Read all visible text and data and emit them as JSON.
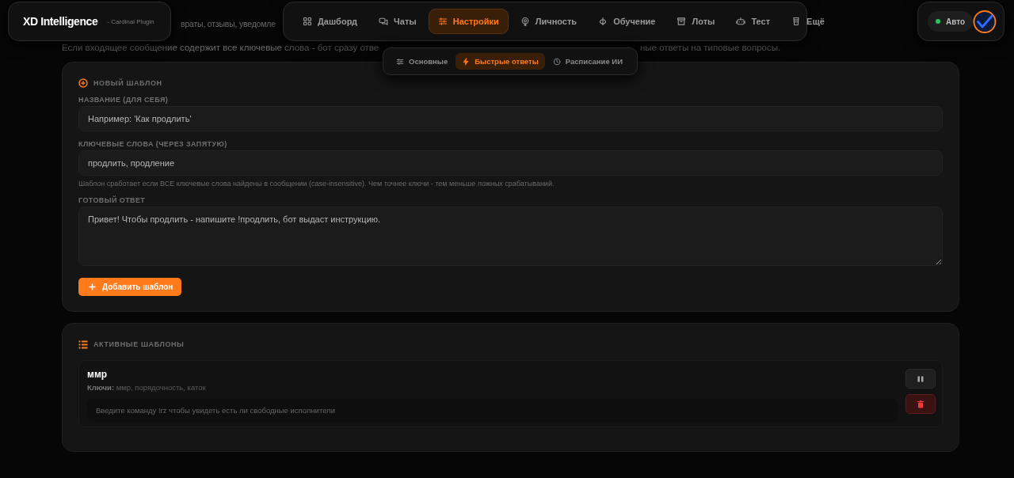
{
  "brand": {
    "title": "XD Intelligence",
    "subtitle": "- Cardinal Plugin"
  },
  "nav": [
    {
      "label": "Дашборд",
      "selected": false
    },
    {
      "label": "Чаты",
      "selected": false
    },
    {
      "label": "Настройки",
      "selected": true
    },
    {
      "label": "Личность",
      "selected": false
    },
    {
      "label": "Обучение",
      "selected": false
    },
    {
      "label": "Лоты",
      "selected": false
    },
    {
      "label": "Тест",
      "selected": false
    },
    {
      "label": "Ещё",
      "selected": false
    }
  ],
  "subnav": [
    {
      "label": "Основные",
      "selected": false
    },
    {
      "label": "Быстрые ответы",
      "selected": true
    },
    {
      "label": "Расписание ИИ",
      "selected": false
    }
  ],
  "status": {
    "label": "Авто",
    "on": true
  },
  "page": {
    "intro_fragment": "враты, отзывы, уведомле",
    "description_start": "Если входящее сообщение содержит все ключевые слова - бот сразу отве",
    "description_end": "ные ответы на типовые вопросы."
  },
  "new_template": {
    "title": "НОВЫЙ ШАБЛОН",
    "name": {
      "label": "НАЗВАНИЕ (ДЛЯ СЕБЯ)",
      "placeholder": "Например: 'Как продлить'"
    },
    "keywords": {
      "label": "КЛЮЧЕВЫЕ СЛОВА (ЧЕРЕЗ ЗАПЯТУЮ)",
      "placeholder": "продлить, продление"
    },
    "hint": "Шаблон сработает если ВСЕ ключевые слова найдены в сообщении (case-insensitive). Чем точнее ключи - тем меньше ложных срабатываний.",
    "answer": {
      "label": "ГОТОВЫЙ ОТВЕТ",
      "placeholder": "Привет! Чтобы продлить - напишите !продлить, бот выдаст инструкцию."
    },
    "button": "Добавить шаблон"
  },
  "active_templates": {
    "title": "АКТИВНЫЕ ШАБЛОНЫ",
    "items": [
      {
        "name": "ммр",
        "keys": "**Ключи:** ммр, порядочность, каток",
        "response_placeholder": "Введите команду !rz чтобы увидеть есть ли свободные исполнители"
      }
    ]
  }
}
